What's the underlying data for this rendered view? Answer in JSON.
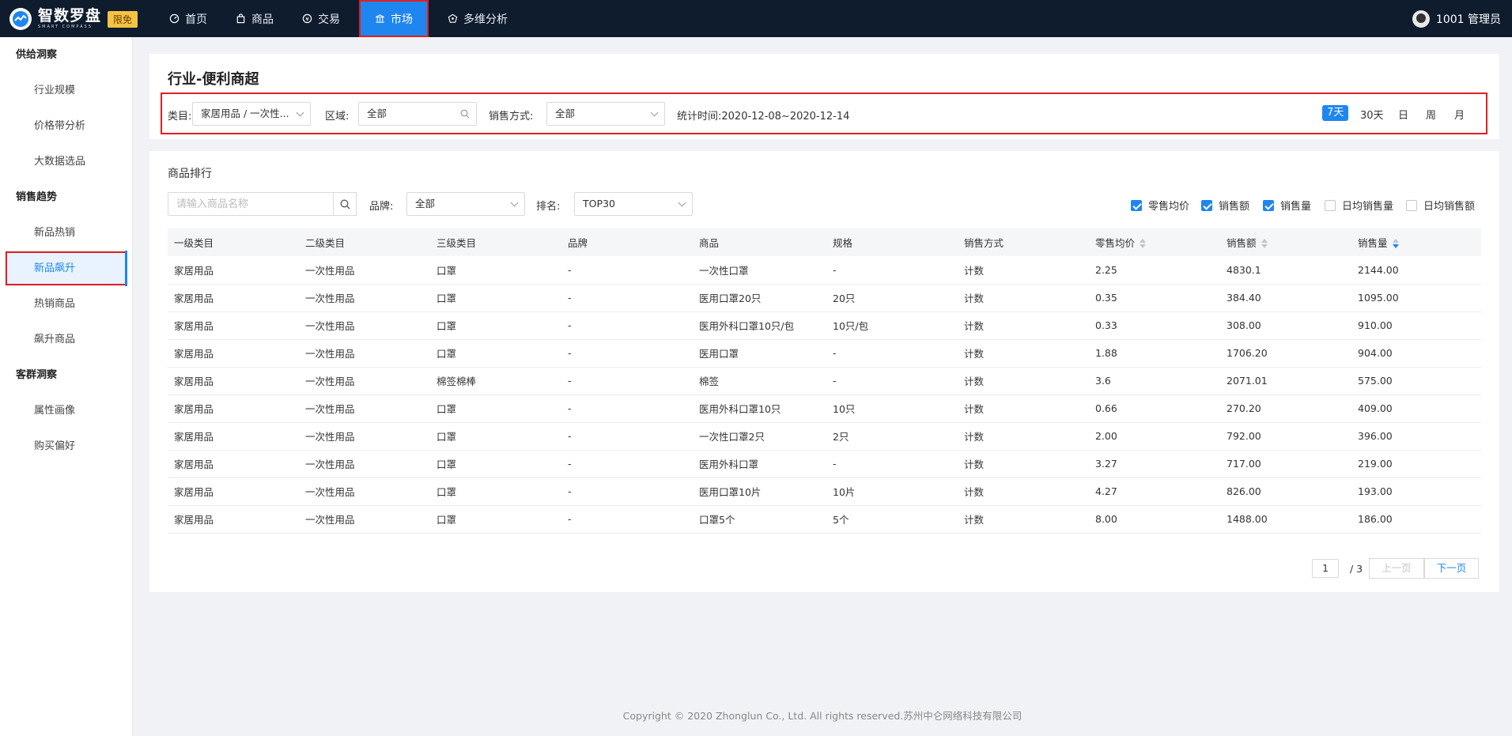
{
  "app": {
    "name": "智数罗盘",
    "subtitle": "SMART COMPASS",
    "badge": "限免"
  },
  "nav": [
    {
      "label": "首页",
      "icon": "dashboard-icon"
    },
    {
      "label": "商品",
      "icon": "bag-icon"
    },
    {
      "label": "交易",
      "icon": "coin-icon"
    },
    {
      "label": "市场",
      "icon": "bank-icon",
      "active": true
    },
    {
      "label": "多维分析",
      "icon": "analysis-icon"
    }
  ],
  "user": {
    "name": "1001 管理员"
  },
  "sidebar": {
    "groups": [
      {
        "title": "供给洞察",
        "items": [
          "行业规模",
          "价格带分析",
          "大数据选品"
        ]
      },
      {
        "title": "销售趋势",
        "items": [
          "新品热销",
          "新品飙升",
          "热销商品",
          "飙升商品"
        ]
      },
      {
        "title": "客群洞察",
        "items": [
          "属性画像",
          "购买偏好"
        ]
      }
    ],
    "active_item": "新品飙升"
  },
  "header": {
    "title": "行业-便利商超",
    "filters": {
      "category_label": "类目:",
      "category_value": "家居用品 / 一次性...",
      "region_label": "区域:",
      "region_value": "全部",
      "sales_mode_label": "销售方式:",
      "sales_mode_value": "全部",
      "stat_time": "统计时间:2020-12-08~2020-12-14"
    },
    "periods": [
      "7天",
      "30天",
      "日",
      "周",
      "月"
    ],
    "active_period": "7天"
  },
  "ranking": {
    "title": "商品排行",
    "search_placeholder": "请输入商品名称",
    "brand_label": "品牌:",
    "brand_value": "全部",
    "rank_label": "排名:",
    "rank_value": "TOP30",
    "metrics": [
      {
        "label": "零售均价",
        "checked": true
      },
      {
        "label": "销售额",
        "checked": true
      },
      {
        "label": "销售量",
        "checked": true
      },
      {
        "label": "日均销售量",
        "checked": false
      },
      {
        "label": "日均销售额",
        "checked": false
      }
    ],
    "columns": [
      "一级类目",
      "二级类目",
      "三级类目",
      "品牌",
      "商品",
      "规格",
      "销售方式",
      "零售均价",
      "销售额",
      "销售量"
    ],
    "rows": [
      [
        "家居用品",
        "一次性用品",
        "口罩",
        "-",
        "一次性口罩",
        "-",
        "计数",
        "2.25",
        "4830.1",
        "2144.00"
      ],
      [
        "家居用品",
        "一次性用品",
        "口罩",
        "-",
        "医用口罩20只",
        "20只",
        "计数",
        "0.35",
        "384.40",
        "1095.00"
      ],
      [
        "家居用品",
        "一次性用品",
        "口罩",
        "-",
        "医用外科口罩10只/包",
        "10只/包",
        "计数",
        "0.33",
        "308.00",
        "910.00"
      ],
      [
        "家居用品",
        "一次性用品",
        "口罩",
        "-",
        "医用口罩",
        "-",
        "计数",
        "1.88",
        "1706.20",
        "904.00"
      ],
      [
        "家居用品",
        "一次性用品",
        "棉签棉棒",
        "-",
        "棉签",
        "-",
        "计数",
        "3.6",
        "2071.01",
        "575.00"
      ],
      [
        "家居用品",
        "一次性用品",
        "口罩",
        "-",
        "医用外科口罩10只",
        "10只",
        "计数",
        "0.66",
        "270.20",
        "409.00"
      ],
      [
        "家居用品",
        "一次性用品",
        "口罩",
        "-",
        "一次性口罩2只",
        "2只",
        "计数",
        "2.00",
        "792.00",
        "396.00"
      ],
      [
        "家居用品",
        "一次性用品",
        "口罩",
        "-",
        "医用外科口罩",
        "-",
        "计数",
        "3.27",
        "717.00",
        "219.00"
      ],
      [
        "家居用品",
        "一次性用品",
        "口罩",
        "-",
        "医用口罩10片",
        "10片",
        "计数",
        "4.27",
        "826.00",
        "193.00"
      ],
      [
        "家居用品",
        "一次性用品",
        "口罩",
        "-",
        "口罩5个",
        "5个",
        "计数",
        "8.00",
        "1488.00",
        "186.00"
      ]
    ],
    "pagination": {
      "current": "1",
      "total": "/ 3",
      "prev": "上一页",
      "next": "下一页"
    }
  },
  "footer": "Copyright © 2020 Zhonglun Co., Ltd. All rights reserved.苏州中仑网络科技有限公司",
  "colors": {
    "primary": "#1f86f0",
    "topbar": "#0e1c2e",
    "highlight": "#e02020"
  }
}
